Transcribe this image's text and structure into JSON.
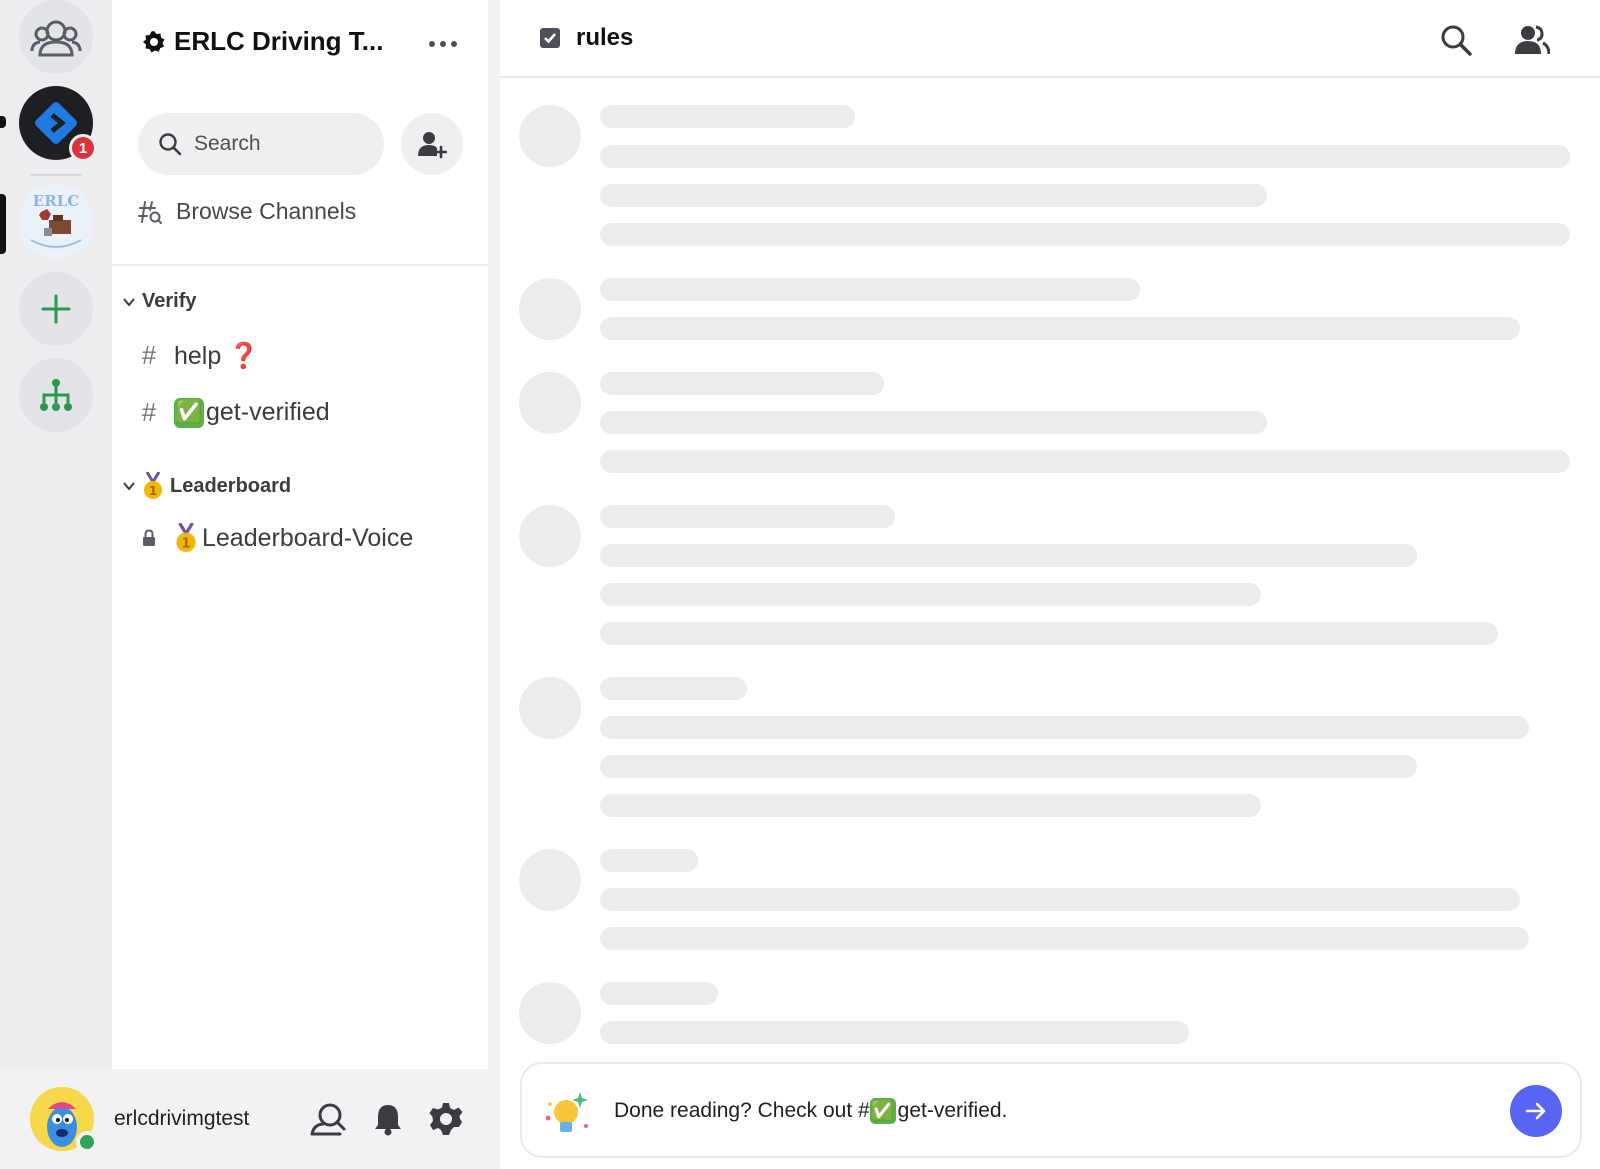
{
  "colors": {
    "accent": "#5865f2",
    "badge": "#d9343b",
    "online": "#2ea45a",
    "green_add": "#2b9a4c",
    "skeleton": "#ececee"
  },
  "rail": {
    "items": [
      {
        "name": "direct-messages",
        "icon": "friends-icon"
      },
      {
        "name": "server-1",
        "icon": "blue-diamond-logo",
        "badge": "1"
      },
      {
        "name": "server-erlc",
        "icon": "erlc-server-icon",
        "label_text": "ERLC"
      },
      {
        "name": "add-server",
        "icon": "plus-icon"
      },
      {
        "name": "discover",
        "icon": "hub-icon"
      }
    ]
  },
  "sidebar": {
    "server_name": "ERLC Driving T...",
    "search_placeholder": "Search",
    "browse_channels": "Browse Channels",
    "categories": [
      {
        "label": "Verify",
        "channels": [
          {
            "name": "help",
            "suffix_emoji": "❓",
            "type": "text"
          },
          {
            "name": "get-verified",
            "prefix_emoji": "✅",
            "type": "text"
          }
        ]
      },
      {
        "label": "Leaderboard",
        "prefix_emoji": "🥇",
        "channels": [
          {
            "name": "Leaderboard-Voice",
            "prefix_emoji": "🥇",
            "type": "locked-voice"
          }
        ]
      }
    ]
  },
  "user_panel": {
    "username": "erlcdrivimgtest",
    "status": "online"
  },
  "main": {
    "channel_name": "rules",
    "notice": {
      "text_before": "Done reading? Check out #",
      "emoji": "✅",
      "text_after": "get-verified."
    }
  }
}
